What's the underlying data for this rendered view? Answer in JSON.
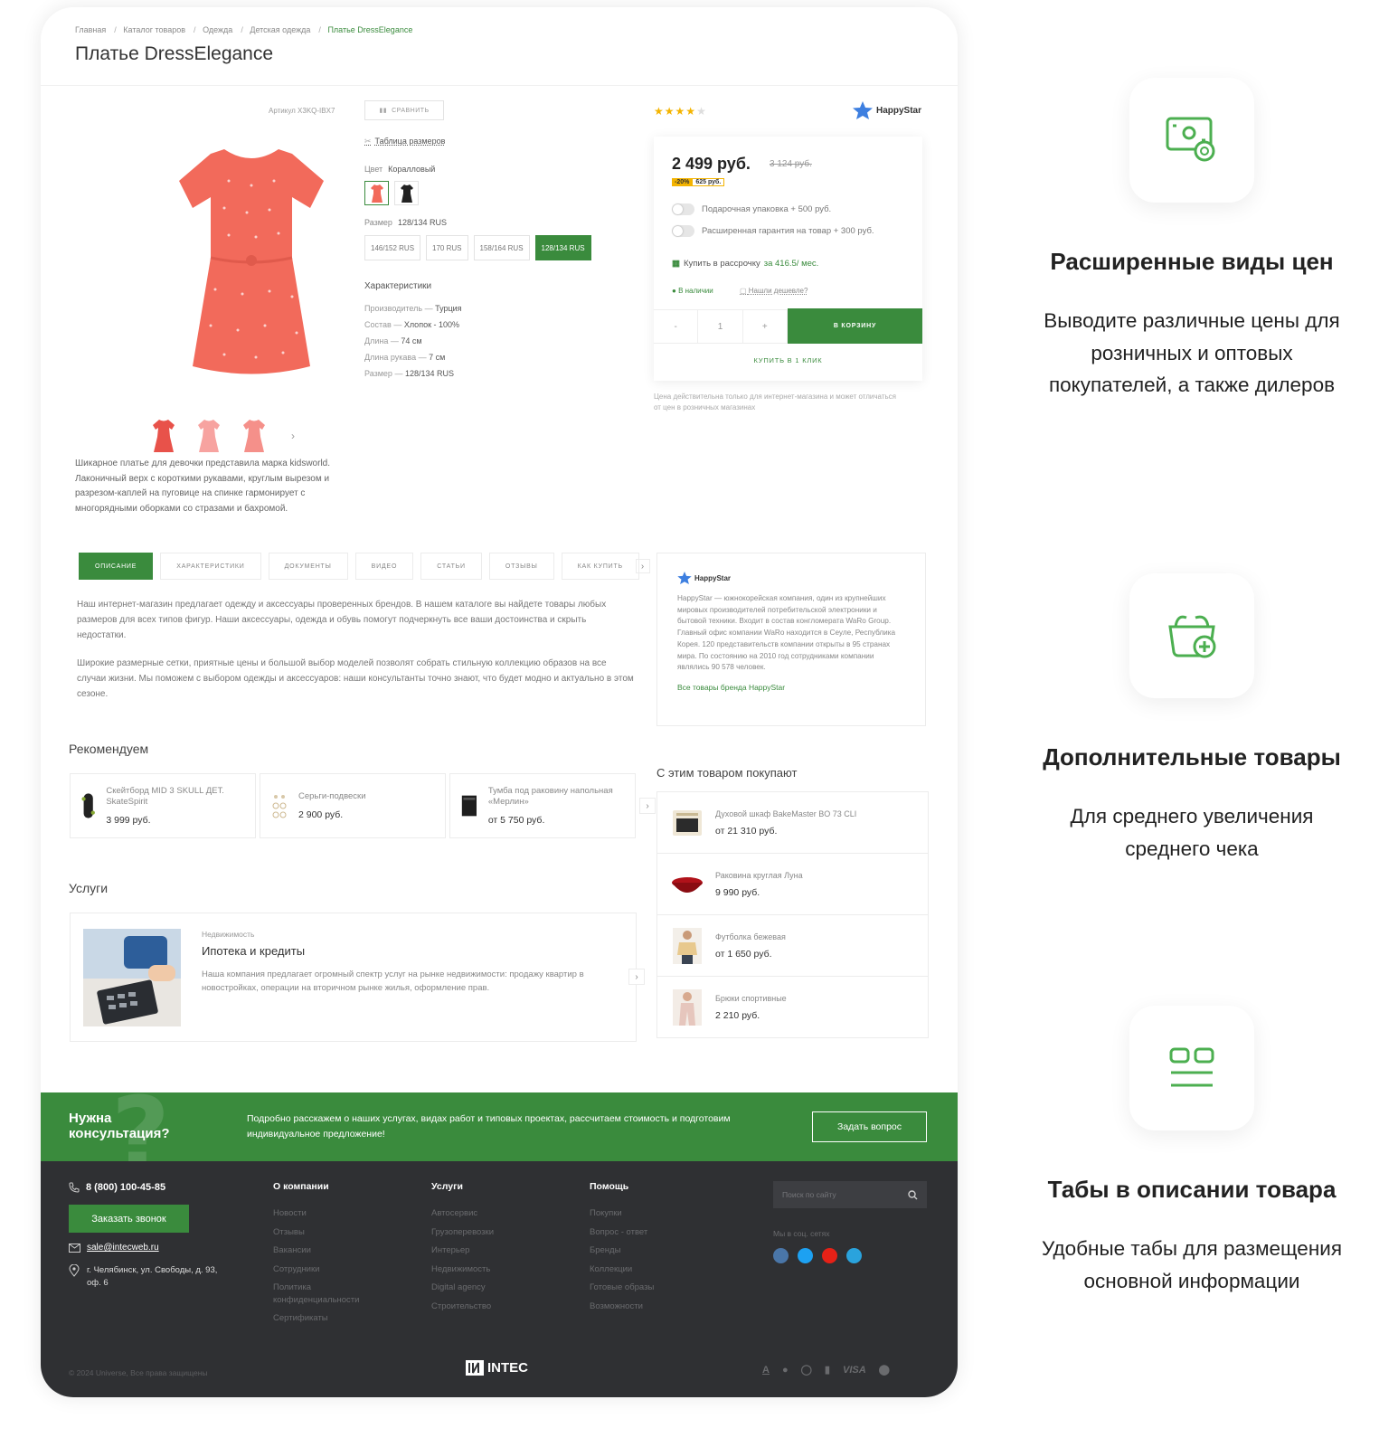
{
  "breadcrumbs": [
    "Главная",
    "Каталог товаров",
    "Одежда",
    "Детская одежда",
    "Платье DressElegance"
  ],
  "product": {
    "title": "Платье DressElegance",
    "sku": "Артикул X3KQ-IBX7",
    "compare_label": "СРАВНИТЬ",
    "size_table": "Таблица размеров",
    "color_label": "Цвет",
    "color_value": "Коралловый",
    "size_label": "Размер",
    "size_value": "128/134 RUS",
    "sizes": [
      "146/152 RUS",
      "170 RUS",
      "158/164 RUS",
      "128/134 RUS"
    ],
    "description": "Шикарное платье для девочки представила марка kidsworld. Лаконичный верх с короткими рукавами, круглым вырезом и разрезом-каплей на пуговице на спинке гармонирует с многорядными оборками со стразами и бахромой.",
    "chars_title": "Характеристики",
    "chars": [
      {
        "k": "Производитель",
        "v": "Турция"
      },
      {
        "k": "Состав",
        "v": "Хлопок - 100%"
      },
      {
        "k": "Длина",
        "v": "74 см"
      },
      {
        "k": "Длина рукава",
        "v": "7 см"
      },
      {
        "k": "Размер",
        "v": "128/134 RUS"
      }
    ],
    "rating": 4,
    "dress_color": "#f26a5b"
  },
  "brand": {
    "name": "HappyStar"
  },
  "price_box": {
    "price": "2 499 руб.",
    "old_price": "3 124 руб.",
    "discount": "-20%",
    "saving": "625 руб.",
    "opt1": "Подарочная упаковка + 500 руб.",
    "opt2": "Расширенная гарантия на товар + 300 руб.",
    "installment": "Купить в рассрочку",
    "installment_price": "за 416.5/ мес.",
    "in_stock": "В наличии",
    "cheaper": "Нашли дешевле?",
    "qty_minus": "-",
    "qty": "1",
    "qty_plus": "+",
    "cart": "В КОРЗИНУ",
    "one_click": "КУПИТЬ В 1 КЛИК",
    "note": "Цена действительна только для интернет-магазина и может отличаться от цен в розничных магазинах"
  },
  "tabs": [
    "ОПИСАНИЕ",
    "ХАРАКТЕРИСТИКИ",
    "ДОКУМЕНТЫ",
    "ВИДЕО",
    "СТАТЬИ",
    "ОТЗЫВЫ",
    "КАК КУПИТЬ"
  ],
  "tab_text": [
    "Наш интернет-магазин предлагает одежду и аксессуары проверенных брендов. В нашем каталоге вы найдете товары любых размеров для всех типов фигур. Наши аксессуары, одежда и обувь помогут подчеркнуть все ваши достоинства и скрыть недостатки.",
    "Широкие размерные сетки, приятные цены и большой выбор моделей позволят собрать стильную коллекцию образов на все случаи жизни. Мы поможем с выбором одежды и аксессуаров: наши консультанты точно знают, что будет модно и актуально в этом сезоне."
  ],
  "brand_box": {
    "text": "HappyStar — южнокорейская компания, один из крупнейших мировых производителей потребительской электроники и бытовой техники. Входит в состав конгломерата WaRo Group. Главный офис компании WaRo находится в Сеуле, Республика Корея. 120 представительств компании открыты в 95 странах мира. По состоянию на 2010 год сотрудниками компании являлись 90 578 человек.",
    "link": "Все товары бренда HappyStar"
  },
  "recommend": {
    "title": "Рекомендуем",
    "items": [
      {
        "name": "Скейтборд MID 3 SKULL ДЕТ. SkateSpirit",
        "price": "3 999 руб."
      },
      {
        "name": "Серьги-подвески",
        "price": "2 900 руб."
      },
      {
        "name": "Тумба под раковину напольная «Мерлин»",
        "price": "от 5 750 руб."
      }
    ]
  },
  "services": {
    "title": "Услуги",
    "item": {
      "category": "Недвижимость",
      "name": "Ипотека и кредиты",
      "text": "Наша компания предлагает огромный спектр услуг на рынке недвижимости: продажу квартир в новостройках, операции на вторичном рынке жилья, оформление прав."
    }
  },
  "also_buy": {
    "title": "С этим товаром покупают",
    "items": [
      {
        "name": "Духовой шкаф BakeMaster BO 73 CLI",
        "price": "от 21 310 руб."
      },
      {
        "name": "Раковина круглая Луна",
        "price": "9 990 руб."
      },
      {
        "name": "Футболка бежевая",
        "price": "от 1 650 руб."
      },
      {
        "name": "Брюки спортивные",
        "price": "2 210 руб."
      }
    ]
  },
  "banner": {
    "title": "Нужна консультация?",
    "text": "Подробно расскажем о наших услугах, видах работ и типовых проектах, рассчитаем стоимость и подготовим индивидуальное предложение!",
    "button": "Задать вопрос"
  },
  "footer": {
    "phone": "8 (800) 100-45-85",
    "call_button": "Заказать звонок",
    "email": "sale@intecweb.ru",
    "address": "г. Челябинск, ул. Свободы, д. 93, оф. 6",
    "cols": [
      {
        "title": "О компании",
        "links": [
          "Новости",
          "Отзывы",
          "Вакансии",
          "Сотрудники",
          "Политика конфиденциальности",
          "Сертификаты"
        ]
      },
      {
        "title": "Услуги",
        "links": [
          "Автосервис",
          "Грузоперевозки",
          "Интерьер",
          "Недвижимость",
          "Digital agency",
          "Строительство"
        ]
      },
      {
        "title": "Помощь",
        "links": [
          "Покупки",
          "Вопрос - ответ",
          "Бренды",
          "Коллекции",
          "Готовые образы",
          "Возможности"
        ]
      }
    ],
    "search_placeholder": "Поиск по сайту",
    "social_title": "Мы в соц. сетях",
    "copyright": "© 2024 Universe, Все права защищены",
    "logo": "INTEC",
    "pay": [
      "A",
      "VISA"
    ]
  },
  "features": [
    {
      "icon": "cash-card-icon",
      "title": "Расширенные виды цен",
      "text": "Выводите различные цены для розничных и оптовых покупателей, а также дилеров"
    },
    {
      "icon": "basket-add-icon",
      "title": "Дополнительные товары",
      "text": "Для среднего увеличения среднего чека"
    },
    {
      "icon": "tabs-layout-icon",
      "title": "Табы в описании товара",
      "text": "Удобные табы для размещения основной информации"
    }
  ],
  "colors": {
    "accent": "#3a8b3d",
    "footer": "#2f3033",
    "star": "#f4b400"
  }
}
